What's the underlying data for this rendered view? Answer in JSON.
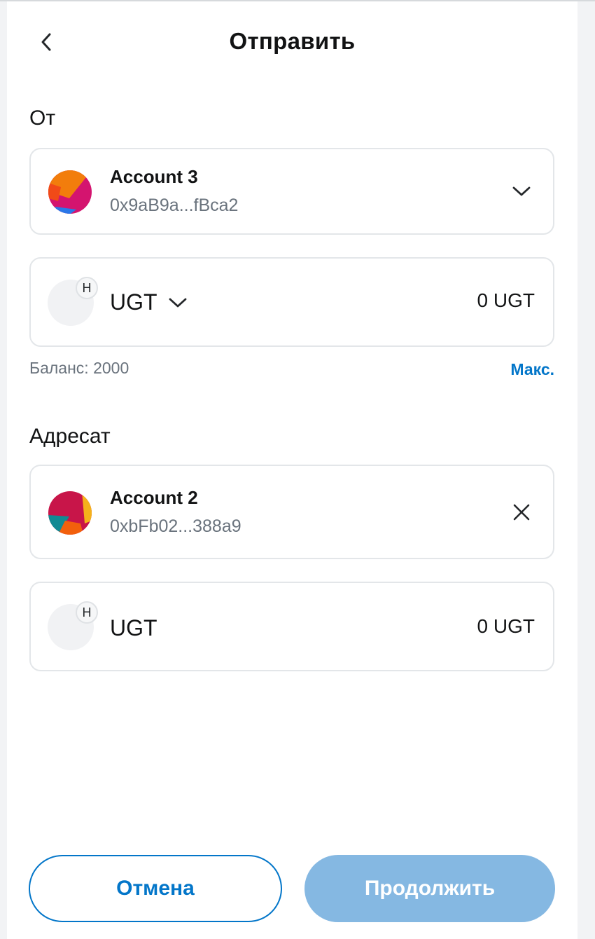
{
  "header": {
    "title": "Отправить",
    "back_icon": "chevron-left-icon"
  },
  "from": {
    "label": "От",
    "account": {
      "name": "Account 3",
      "address": "0x9aB9a...fBca2",
      "dropdown_icon": "chevron-down-icon"
    },
    "asset": {
      "badge": "H",
      "symbol": "UGT",
      "amount": "0 UGT",
      "dropdown_icon": "chevron-down-icon"
    },
    "balance": "Баланс: 2000",
    "max_label": "Макс."
  },
  "to": {
    "label": "Адресат",
    "account": {
      "name": "Account 2",
      "address": "0xbFb02...388a9",
      "clear_icon": "close-icon"
    },
    "asset": {
      "badge": "H",
      "symbol": "UGT",
      "amount": "0 UGT"
    }
  },
  "footer": {
    "cancel_label": "Отмена",
    "continue_label": "Продолжить"
  },
  "colors": {
    "accent": "#0376c9",
    "disabled_primary": "#85b8e2",
    "border": "#e3e6e9",
    "muted_text": "#6a737d"
  }
}
